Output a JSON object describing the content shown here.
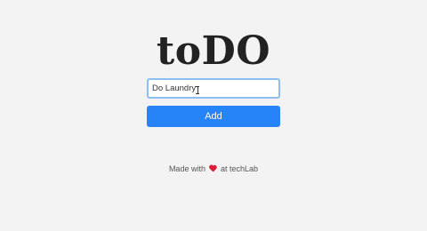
{
  "app": {
    "title": "toDO"
  },
  "form": {
    "input_value": "Do Laundry",
    "input_placeholder": "",
    "add_label": "Add"
  },
  "footer": {
    "made_with": "Made with",
    "heart_icon": "heart-icon",
    "at_text": "at techLab"
  },
  "colors": {
    "accent": "#2784f8",
    "background": "#f3f3f4",
    "heart": "#d81e3a"
  }
}
